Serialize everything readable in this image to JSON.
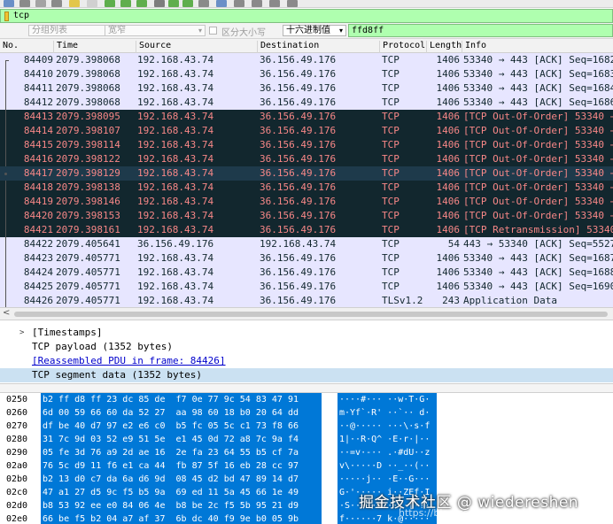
{
  "toolbar": {
    "icons": [
      {
        "name": "open-file-icon",
        "color": "#6a8fc7"
      },
      {
        "name": "save-file-icon",
        "color": "#8a8a8a"
      },
      {
        "name": "close-file-icon",
        "color": "#a3a3a3"
      },
      {
        "name": "reload-icon",
        "color": "#8a8a8a"
      },
      {
        "name": "find-packet-icon",
        "color": "#e2c64a"
      },
      {
        "name": "clear-icon",
        "color": "#d0d0d0"
      },
      {
        "name": "go-back-icon",
        "color": "#5fae4d"
      },
      {
        "name": "go-forward-icon",
        "color": "#5fae4d"
      },
      {
        "name": "go-to-packet-icon",
        "color": "#5fae4d"
      },
      {
        "name": "first-packet-icon",
        "color": "#7d7d7d"
      },
      {
        "name": "prev-packet-icon",
        "color": "#5fae4d"
      },
      {
        "name": "next-packet-icon",
        "color": "#5fae4d"
      },
      {
        "name": "autoscroll-icon",
        "color": "#8a8a8a"
      },
      {
        "name": "colorize-icon",
        "color": "#6a8fc7"
      },
      {
        "name": "zoom-in-icon",
        "color": "#8a8a8a"
      },
      {
        "name": "zoom-out-icon",
        "color": "#8a8a8a"
      },
      {
        "name": "zoom-normal-icon",
        "color": "#8a8a8a"
      },
      {
        "name": "resize-columns-icon",
        "color": "#8a8a8a"
      }
    ]
  },
  "filter": {
    "value": "tcp",
    "accent": "#afffaf"
  },
  "find": {
    "scope_label": "分组列表",
    "charset_label": "宽窄",
    "case_label": "区分大小写",
    "mode_label": "十六进制值",
    "value": "ffd8ff"
  },
  "packet_list": {
    "columns": [
      "No.",
      "Time",
      "Source",
      "Destination",
      "Protocol",
      "Length",
      "Info"
    ],
    "rows": [
      {
        "no": "84409",
        "time": "2079.398068",
        "src": "192.168.43.74",
        "dst": "36.156.49.176",
        "proto": "TCP",
        "len": "1406",
        "info": "53340 → 443 [ACK] Seq=1682",
        "style": "tcp",
        "mark": "first"
      },
      {
        "no": "84410",
        "time": "2079.398068",
        "src": "192.168.43.74",
        "dst": "36.156.49.176",
        "proto": "TCP",
        "len": "1406",
        "info": "53340 → 443 [ACK] Seq=1683",
        "style": "tcp",
        "mark": "mid"
      },
      {
        "no": "84411",
        "time": "2079.398068",
        "src": "192.168.43.74",
        "dst": "36.156.49.176",
        "proto": "TCP",
        "len": "1406",
        "info": "53340 → 443 [ACK] Seq=1684",
        "style": "tcp",
        "mark": "mid"
      },
      {
        "no": "84412",
        "time": "2079.398068",
        "src": "192.168.43.74",
        "dst": "36.156.49.176",
        "proto": "TCP",
        "len": "1406",
        "info": "53340 → 443 [ACK] Seq=1686",
        "style": "tcp",
        "mark": "mid"
      },
      {
        "no": "84413",
        "time": "2079.398095",
        "src": "192.168.43.74",
        "dst": "36.156.49.176",
        "proto": "TCP",
        "len": "1406",
        "info": "[TCP Out-Of-Order] 53340 →",
        "style": "bad",
        "mark": "mid"
      },
      {
        "no": "84414",
        "time": "2079.398107",
        "src": "192.168.43.74",
        "dst": "36.156.49.176",
        "proto": "TCP",
        "len": "1406",
        "info": "[TCP Out-Of-Order] 53340 →",
        "style": "bad",
        "mark": "mid"
      },
      {
        "no": "84415",
        "time": "2079.398114",
        "src": "192.168.43.74",
        "dst": "36.156.49.176",
        "proto": "TCP",
        "len": "1406",
        "info": "[TCP Out-Of-Order] 53340 →",
        "style": "bad",
        "mark": "mid"
      },
      {
        "no": "84416",
        "time": "2079.398122",
        "src": "192.168.43.74",
        "dst": "36.156.49.176",
        "proto": "TCP",
        "len": "1406",
        "info": "[TCP Out-Of-Order] 53340 →",
        "style": "bad",
        "mark": "mid"
      },
      {
        "no": "84417",
        "time": "2079.398129",
        "src": "192.168.43.74",
        "dst": "36.156.49.176",
        "proto": "TCP",
        "len": "1406",
        "info": "[TCP Out-Of-Order] 53340 →",
        "style": "sel",
        "mark": "dot"
      },
      {
        "no": "84418",
        "time": "2079.398138",
        "src": "192.168.43.74",
        "dst": "36.156.49.176",
        "proto": "TCP",
        "len": "1406",
        "info": "[TCP Out-Of-Order] 53340 →",
        "style": "bad",
        "mark": "mid"
      },
      {
        "no": "84419",
        "time": "2079.398146",
        "src": "192.168.43.74",
        "dst": "36.156.49.176",
        "proto": "TCP",
        "len": "1406",
        "info": "[TCP Out-Of-Order] 53340 →",
        "style": "bad",
        "mark": "mid"
      },
      {
        "no": "84420",
        "time": "2079.398153",
        "src": "192.168.43.74",
        "dst": "36.156.49.176",
        "proto": "TCP",
        "len": "1406",
        "info": "[TCP Out-Of-Order] 53340 →",
        "style": "bad",
        "mark": "mid"
      },
      {
        "no": "84421",
        "time": "2079.398161",
        "src": "192.168.43.74",
        "dst": "36.156.49.176",
        "proto": "TCP",
        "len": "1406",
        "info": "[TCP Retransmission] 53340",
        "style": "bad",
        "mark": "mid"
      },
      {
        "no": "84422",
        "time": "2079.405641",
        "src": "36.156.49.176",
        "dst": "192.168.43.74",
        "proto": "TCP",
        "len": "54",
        "info": "443 → 53340 [ACK] Seq=5527",
        "style": "tcp",
        "mark": "mid"
      },
      {
        "no": "84423",
        "time": "2079.405771",
        "src": "192.168.43.74",
        "dst": "36.156.49.176",
        "proto": "TCP",
        "len": "1406",
        "info": "53340 → 443 [ACK] Seq=1687",
        "style": "tcp",
        "mark": "mid"
      },
      {
        "no": "84424",
        "time": "2079.405771",
        "src": "192.168.43.74",
        "dst": "36.156.49.176",
        "proto": "TCP",
        "len": "1406",
        "info": "53340 → 443 [ACK] Seq=1688",
        "style": "tcp",
        "mark": "mid"
      },
      {
        "no": "84425",
        "time": "2079.405771",
        "src": "192.168.43.74",
        "dst": "36.156.49.176",
        "proto": "TCP",
        "len": "1406",
        "info": "53340 → 443 [ACK] Seq=1690",
        "style": "tcp",
        "mark": "mid"
      },
      {
        "no": "84426",
        "time": "2079.405771",
        "src": "192.168.43.74",
        "dst": "36.156.49.176",
        "proto": "TLSv1.2",
        "len": "243",
        "info": "Application Data",
        "style": "tls",
        "mark": "mid"
      }
    ]
  },
  "detail": {
    "timestamps": "[Timestamps]",
    "payload": "TCP payload (1352 bytes)",
    "reassembled": "[Reassembled PDU in frame: 84426]",
    "segment": "TCP segment data (1352 bytes)"
  },
  "hex": {
    "rows": [
      {
        "off": "0250",
        "bytes": "b2 ff d8 ff 23 dc 85 de  f7 0e 77 9c 54 83 47 91",
        "ascii": "····#··· ··w·T·G·"
      },
      {
        "off": "0260",
        "bytes": "6d 00 59 66 60 da 52 27  aa 98 60 18 b0 20 64 dd",
        "ascii": "m·Yf`·R' ··`·· d·"
      },
      {
        "off": "0270",
        "bytes": "df be 40 d7 97 e2 e6 c0  b5 fc 05 5c c1 73 f8 66",
        "ascii": "··@····· ···\\·s·f"
      },
      {
        "off": "0280",
        "bytes": "31 7c 9d 03 52 e9 51 5e  e1 45 0d 72 a8 7c 9a f4",
        "ascii": "1|··R·Q^ ·E·r·|··"
      },
      {
        "off": "0290",
        "bytes": "05 fe 3d 76 a9 2d ae 16  2e fa 23 64 55 b5 cf 7a",
        "ascii": "··=v·-·· .·#dU··z"
      },
      {
        "off": "02a0",
        "bytes": "76 5c d9 11 f6 e1 ca 44  fb 87 5f 16 eb 28 cc 97",
        "ascii": "v\\·····D ··_··(··"
      },
      {
        "off": "02b0",
        "bytes": "b2 13 d0 c7 da 6a d6 9d  08 45 d2 bd 47 89 14 d7",
        "ascii": "·····j·· ·E··G···"
      },
      {
        "off": "02c0",
        "bytes": "47 a1 27 d5 9c f5 b5 9a  69 ed 11 5a 45 66 1e 49",
        "ascii": "G·'····· i··ZEf·I"
      },
      {
        "off": "02d0",
        "bytes": "b8 53 92 ee e0 84 06 4e  b8 be 2c f5 5b 95 21 d9",
        "ascii": "·S·····N ··,·[·!·"
      },
      {
        "off": "02e0",
        "bytes": "66 be f5 b2 04 a7 af 37  6b dc 40 f9 9e b0 05 9b",
        "ascii": "f······7 k·@·····"
      }
    ],
    "selection_color": "#0078d7"
  },
  "watermark": {
    "main": "掘金技术社区 @ wiedereshen",
    "sub": "https://blog.csdn.net"
  }
}
